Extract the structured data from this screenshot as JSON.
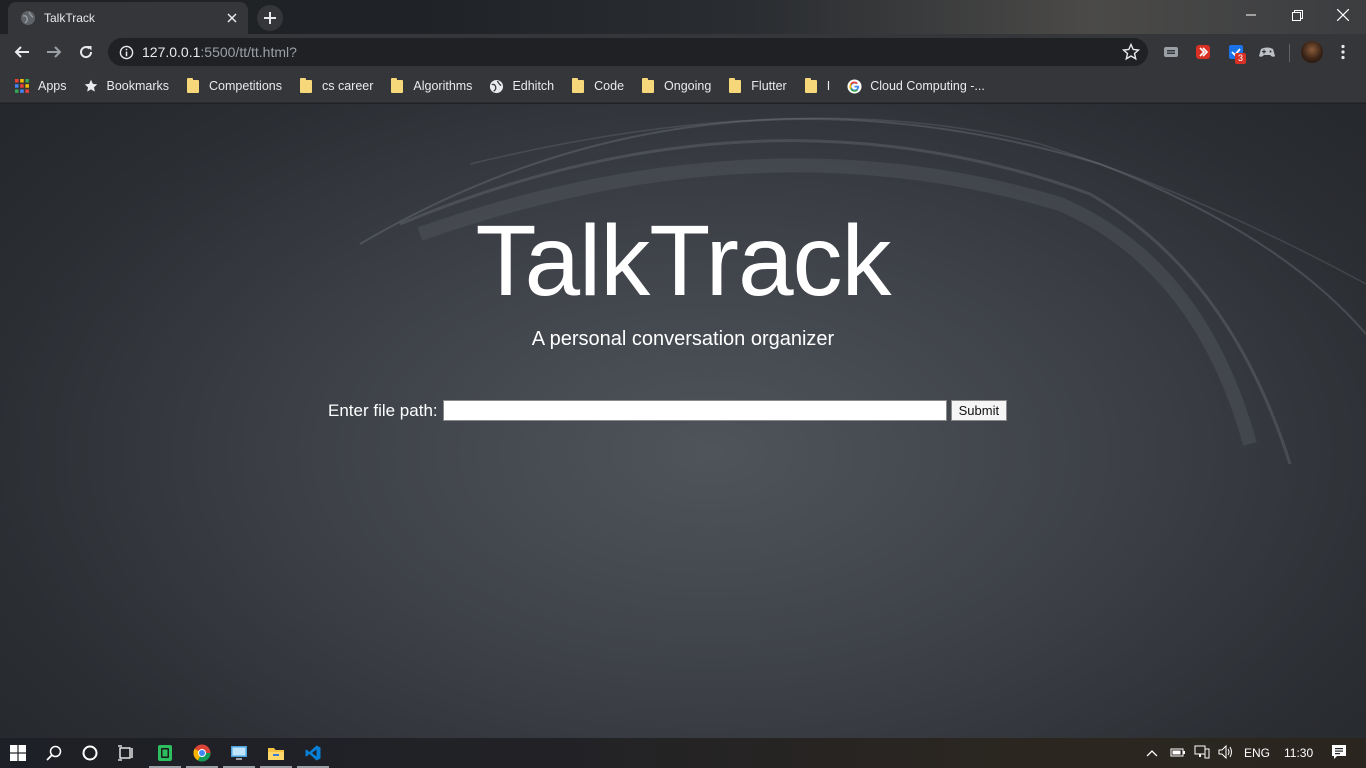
{
  "browser": {
    "tab": {
      "title": "TalkTrack",
      "favicon": "globe-icon"
    },
    "new_tab_icon": "plus-icon",
    "window_controls": [
      "minimize-icon",
      "restore-icon",
      "close-icon"
    ],
    "address": {
      "host": "127.0.0.1",
      "rest": ":5500/tt/tt.html?"
    },
    "extensions": [
      {
        "icon": "extension-grey-icon"
      },
      {
        "icon": "extension-red-icon"
      },
      {
        "icon": "extension-check-icon",
        "badge": "3"
      },
      {
        "icon": "extension-gamepad-icon"
      }
    ]
  },
  "bookmarks": [
    {
      "label": "Apps",
      "icon": "apps-grid-icon"
    },
    {
      "label": "Bookmarks",
      "icon": "star-icon"
    },
    {
      "label": "Competitions",
      "icon": "folder-icon"
    },
    {
      "label": "cs career",
      "icon": "folder-icon"
    },
    {
      "label": "Algorithms",
      "icon": "folder-icon"
    },
    {
      "label": "Edhitch",
      "icon": "globe-icon"
    },
    {
      "label": "Code",
      "icon": "folder-icon"
    },
    {
      "label": "Ongoing",
      "icon": "folder-icon"
    },
    {
      "label": "Flutter",
      "icon": "folder-icon"
    },
    {
      "label": "I",
      "icon": "folder-icon"
    },
    {
      "label": "Cloud Computing -...",
      "icon": "google-icon"
    }
  ],
  "page": {
    "title": "TalkTrack",
    "subtitle": "A personal conversation organizer",
    "form": {
      "label": "Enter file path:",
      "input_value": "",
      "submit_label": "Submit"
    }
  },
  "taskbar": {
    "apps": [
      "windows-start-icon",
      "search-icon",
      "cortana-icon",
      "task-view-icon",
      "evernote-icon",
      "chrome-icon",
      "remote-desktop-icon",
      "file-explorer-icon",
      "vscode-icon"
    ],
    "tray": {
      "language": "ENG",
      "time": "11:30"
    }
  }
}
